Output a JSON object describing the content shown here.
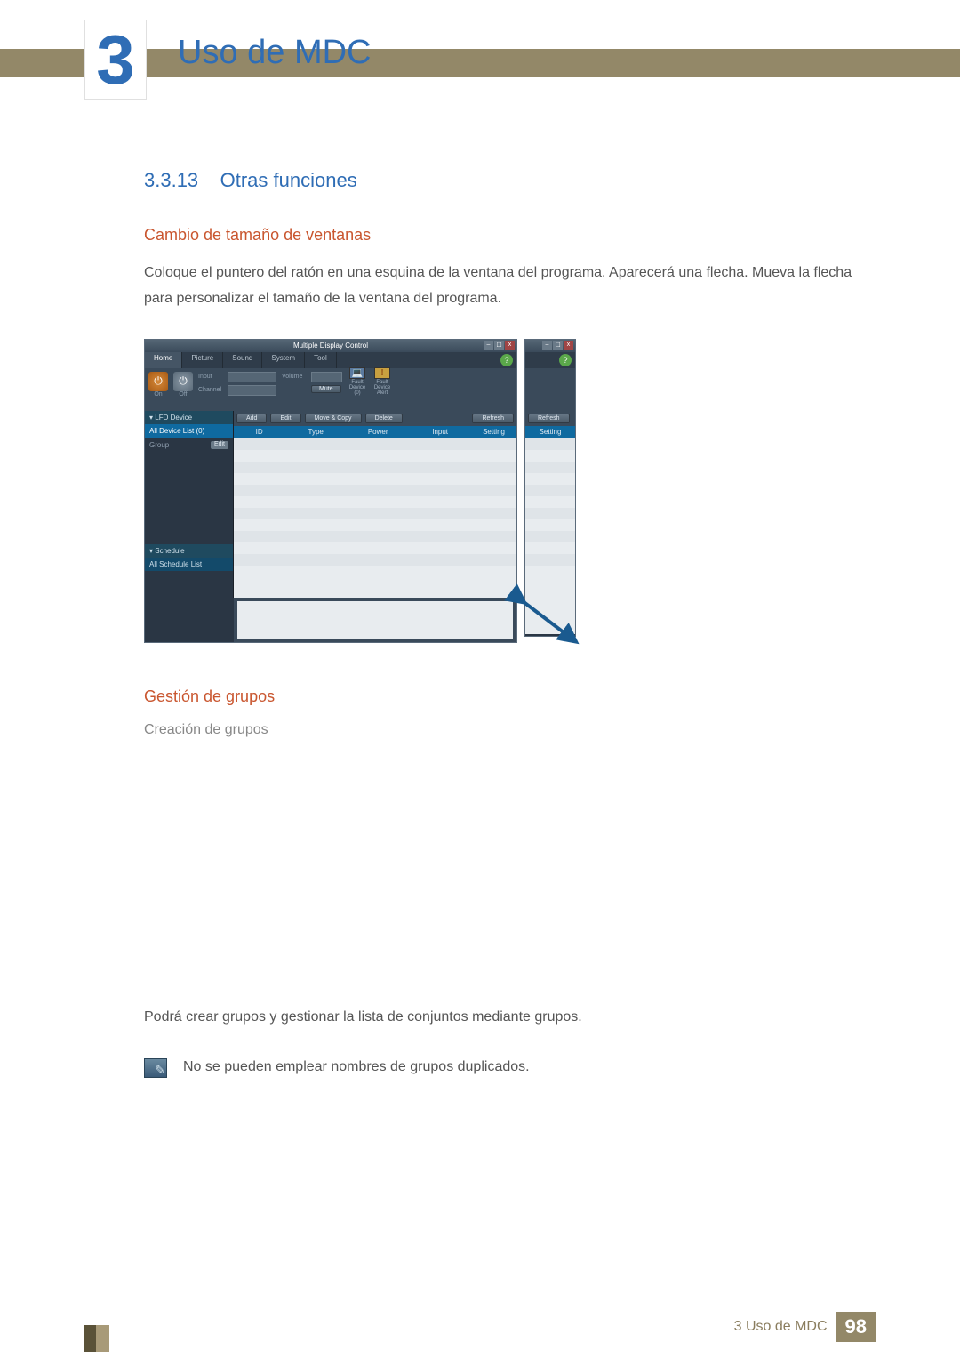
{
  "chapter": {
    "number": "3",
    "title": "Uso de MDC"
  },
  "section": {
    "number": "3.3.13",
    "title": "Otras funciones"
  },
  "sub_resize": {
    "heading": "Cambio de tamaño de ventanas",
    "body": "Coloque el puntero del ratón en una esquina de la ventana del programa. Aparecerá una flecha. Mueva la flecha para personalizar el tamaño de la ventana del programa."
  },
  "mdc_window": {
    "title": "Multiple Display Control",
    "win_min": "–",
    "win_max": "☐",
    "win_close": "x",
    "help_badge": "?",
    "tabs": [
      "Home",
      "Picture",
      "Sound",
      "System",
      "Tool"
    ],
    "toolbar": {
      "on_label": "On",
      "off_label": "Off",
      "input_label": "Input",
      "channel_label": "Channel",
      "volume_label": "Volume",
      "mute_label": "Mute",
      "fault_device_label": "Fault Device (0)",
      "fault_alert_label": "Fault Device Alert"
    },
    "sidebar": {
      "lfd_device": "LFD Device",
      "all_device_list": "All Device List (0)",
      "group_label": "Group",
      "edit_chip": "Edit",
      "schedule": "Schedule",
      "all_schedule_list": "All Schedule List"
    },
    "actions": {
      "add": "Add",
      "edit": "Edit",
      "move_copy": "Move & Copy",
      "delete": "Delete",
      "refresh": "Refresh"
    },
    "columns": [
      "ID",
      "Type",
      "Power",
      "Input",
      "Setting"
    ]
  },
  "sub_groups": {
    "heading": "Gestión de grupos",
    "creation": "Creación de grupos",
    "body1": "Podrá crear grupos y gestionar la lista de conjuntos mediante grupos.",
    "note": "No se pueden emplear nombres de grupos duplicados."
  },
  "footer": {
    "label": "3 Uso de MDC",
    "page": "98"
  }
}
